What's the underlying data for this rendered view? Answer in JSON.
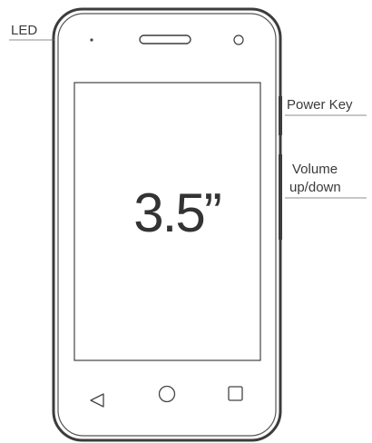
{
  "labels": {
    "led": "LED",
    "power_key": "Power Key",
    "volume_line1": "Volume",
    "volume_line2": "up/down"
  },
  "screen": {
    "size_text": "3.5”"
  },
  "icons": {
    "back": "back-triangle-icon",
    "home": "home-circle-icon",
    "recents": "recents-square-icon",
    "earpiece": "earpiece-slot-icon",
    "camera": "front-camera-icon",
    "led": "led-dot-icon"
  },
  "colors": {
    "outline": "#3c3c3c",
    "label_text": "#3a3a3a"
  }
}
